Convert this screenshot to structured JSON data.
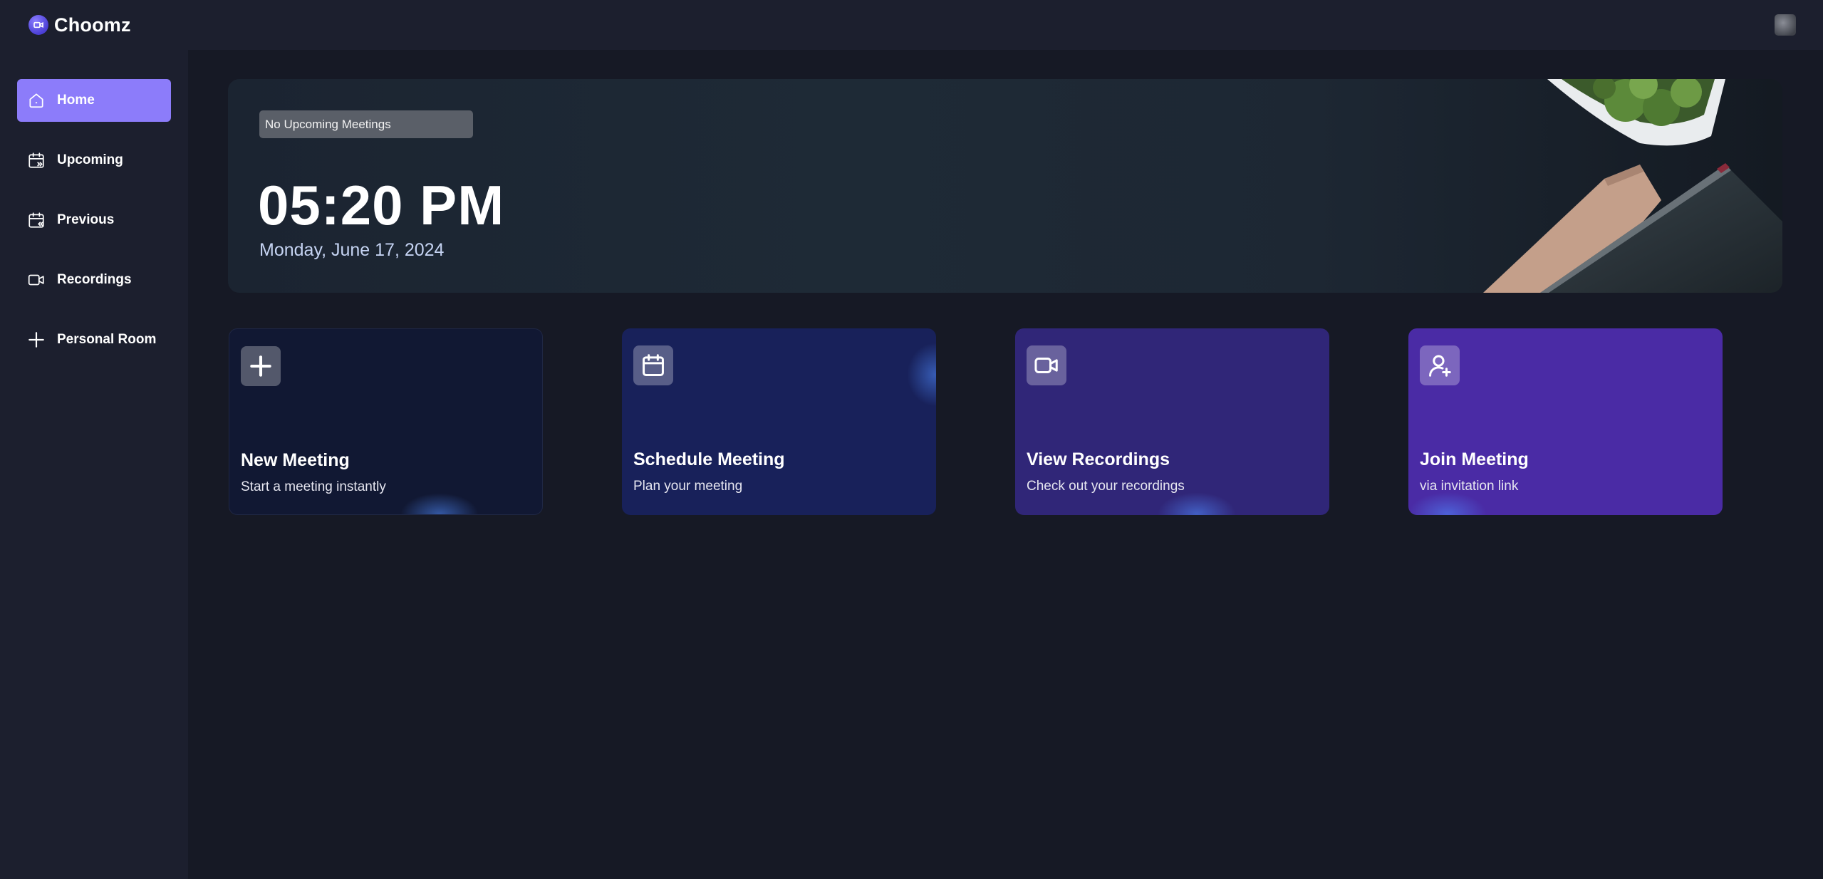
{
  "app": {
    "name": "Choomz"
  },
  "sidebar": {
    "items": [
      {
        "label": "Home",
        "icon": "home-icon",
        "active": true
      },
      {
        "label": "Upcoming",
        "icon": "calendar-upcoming-icon",
        "active": false
      },
      {
        "label": "Previous",
        "icon": "calendar-previous-icon",
        "active": false
      },
      {
        "label": "Recordings",
        "icon": "video-icon",
        "active": false
      },
      {
        "label": "Personal Room",
        "icon": "plus-icon",
        "active": false
      }
    ]
  },
  "hero": {
    "badge": "No Upcoming Meetings",
    "time": "05:20 PM",
    "date": "Monday, June 17, 2024"
  },
  "cards": [
    {
      "title": "New Meeting",
      "subtitle": "Start a meeting instantly",
      "icon": "plus-icon",
      "color": "#111833"
    },
    {
      "title": "Schedule Meeting",
      "subtitle": "Plan your meeting",
      "icon": "calendar-icon",
      "color": "#18215a"
    },
    {
      "title": "View Recordings",
      "subtitle": "Check out your recordings",
      "icon": "video-icon",
      "color": "#302678"
    },
    {
      "title": "Join Meeting",
      "subtitle": "via invitation link",
      "icon": "user-plus-icon",
      "color": "#4a2ba5"
    }
  ],
  "colors": {
    "accent": "#8c7cfa",
    "background": "#161925",
    "panel": "#1c1f2e"
  }
}
